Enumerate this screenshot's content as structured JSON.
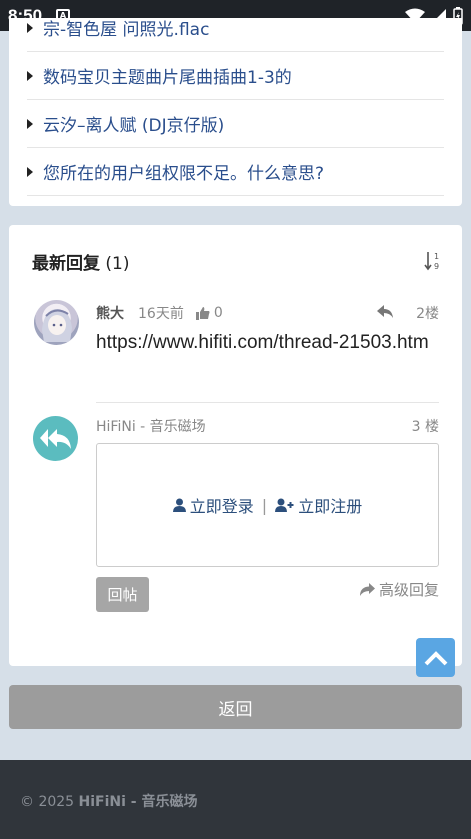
{
  "status": {
    "time": "8:50"
  },
  "threads": [
    {
      "title": "宗-智色屋 问照光.flac"
    },
    {
      "title": "数码宝贝主题曲片尾曲插曲1-3的"
    },
    {
      "title": "云汐–离人赋 (DJ京仔版)"
    },
    {
      "title": "您所在的用户组权限不足。什么意思?"
    }
  ],
  "replies": {
    "heading": "最新回复",
    "count": "(1)",
    "post": {
      "author": "熊大",
      "time": "16天前",
      "likes": "0",
      "floor": "2楼",
      "content": "https://www.hifiti.com/thread-21503.htm"
    },
    "composer": {
      "site": "HiFiNi - 音乐磁场",
      "floor": "3 楼",
      "login": "立即登录",
      "separator": "|",
      "register": "立即注册",
      "submit": "回帖",
      "advanced": "高级回复"
    }
  },
  "back": "返回",
  "footer": {
    "copy": "© 2025 ",
    "site": "HiFiNi - 音乐磁场"
  },
  "colors": {
    "link": "#2a4e8c",
    "topbtn": "#5aa6e3",
    "footer": "#30353b"
  }
}
